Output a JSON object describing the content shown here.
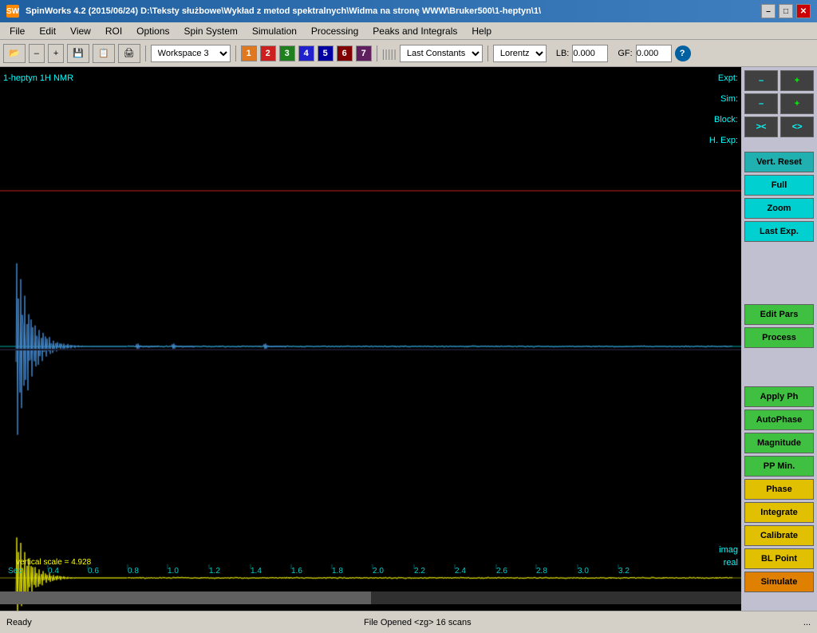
{
  "titlebar": {
    "app_name": "SpinWorks 4.2  (2015/06/24)  D:\\Teksty służbowe\\Wykład z metod spektralnych\\Widma na stronę WWW\\Bruker500\\1-heptyn\\1\\",
    "icon": "SW"
  },
  "window_controls": {
    "minimize": "–",
    "maximize": "□",
    "close": "✕"
  },
  "menu": {
    "items": [
      "File",
      "Edit",
      "View",
      "ROI",
      "Options",
      "Spin System",
      "Simulation",
      "Processing",
      "Peaks and Integrals",
      "Help"
    ]
  },
  "toolbar": {
    "open_icon": "📂",
    "minus_btn": "–",
    "plus_btn": "+",
    "save_icon": "💾",
    "print_icon": "🖨",
    "workspace_label": "Workspace 3",
    "num_buttons": [
      "1",
      "2",
      "3",
      "4",
      "5",
      "6",
      "7"
    ],
    "last_constants_label": "Last Constants",
    "lorentz_label": "Lorentz",
    "lb_label": "LB:",
    "lb_value": "0.000",
    "gf_label": "GF:",
    "gf_value": "0.000",
    "help_icon": "?"
  },
  "spectrum": {
    "title": "1-heptyn 1H NMR",
    "expt_label": "Expt:",
    "sim_label": "Sim:",
    "block_label": "Block:",
    "hexp_label": "H. Exp:",
    "imag_label": "imag",
    "real_label": "real",
    "vertical_scale": "vertical scale = 4.928",
    "x_unit": "Sec",
    "x_labels": [
      "0.4",
      "0.6",
      "0.8",
      "1.0",
      "1.2",
      "1.4",
      "1.6",
      "1.8",
      "2.0",
      "2.2",
      "2.4",
      "2.6",
      "2.8",
      "3.0",
      "3.2"
    ]
  },
  "right_panel": {
    "expt_minus": "–",
    "expt_plus": "+",
    "sim_minus": "–",
    "sim_plus": "+",
    "hexp_left": "><",
    "hexp_right": "<>",
    "vert_reset": "Vert. Reset",
    "full": "Full",
    "zoom": "Zoom",
    "last_exp": "Last Exp.",
    "edit_pars": "Edit Pars",
    "process": "Process",
    "apply_ph": "Apply Ph",
    "autophase": "AutoPhase",
    "magnitude": "Magnitude",
    "pp_min": "PP Min.",
    "phase": "Phase",
    "integrate": "Integrate",
    "calibrate": "Calibrate",
    "bl_point": "BL Point",
    "simulate": "Simulate"
  },
  "statusbar": {
    "ready": "Ready",
    "file_info": "File Opened  <zg>  16 scans",
    "dots": "..."
  }
}
